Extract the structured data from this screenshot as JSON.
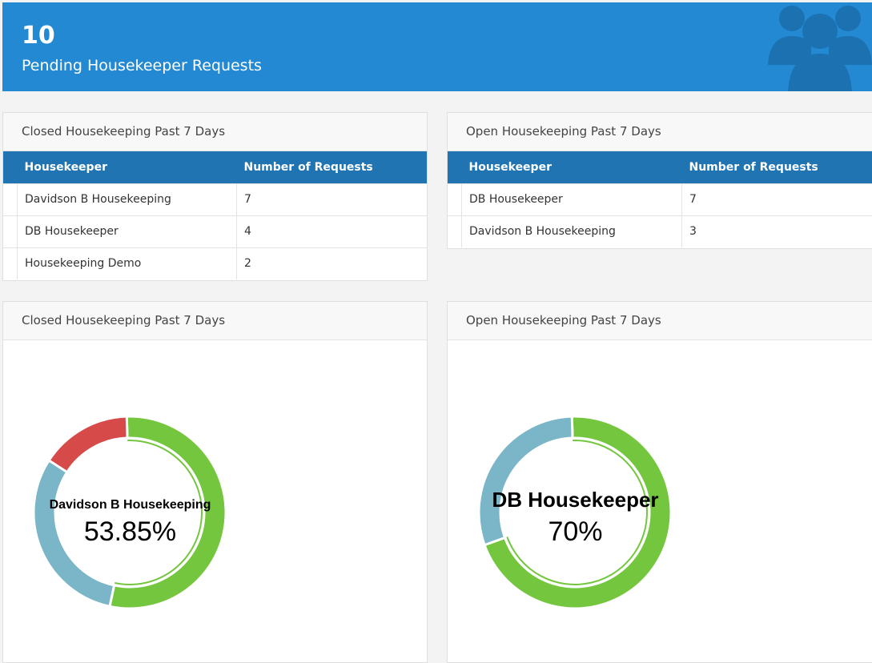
{
  "banner": {
    "count": "10",
    "label": "Pending Housekeeper Requests",
    "icon": "users-icon",
    "color": "#2489d3"
  },
  "closed_table": {
    "title": "Closed Housekeeping Past 7 Days",
    "columns": [
      "Housekeeper",
      "Number of Requests"
    ],
    "rows": [
      [
        "Davidson B Housekeeping",
        "7"
      ],
      [
        "DB Housekeeper",
        "4"
      ],
      [
        "Housekeeping Demo",
        "2"
      ]
    ]
  },
  "open_table": {
    "title": "Open Housekeeping Past 7 Days",
    "columns": [
      "Housekeeper",
      "Number of Requests"
    ],
    "rows": [
      [
        "DB Housekeeper",
        "7"
      ],
      [
        "Davidson B Housekeeping",
        "3"
      ]
    ]
  },
  "closed_chart": {
    "title": "Closed Housekeeping Past 7 Days",
    "center_name": "Davidson B Housekeeping",
    "center_value": "53.85%"
  },
  "open_chart": {
    "title": "Open Housekeeping Past 7 Days",
    "center_name": "DB Housekeeper",
    "center_value": "70%"
  },
  "chart_data": [
    {
      "type": "pie",
      "title": "",
      "categories": [
        "Davidson B Housekeeping",
        "DB Housekeeper",
        "Housekeeping Demo"
      ],
      "values": [
        7,
        4,
        2
      ],
      "colors": [
        "#74c63f",
        "#7ab6c8",
        "#d64a4a"
      ]
    },
    {
      "type": "pie",
      "title": "",
      "categories": [
        "DB Housekeeper",
        "Davidson B Housekeeping"
      ],
      "values": [
        7,
        3
      ],
      "colors": [
        "#74c63f",
        "#7ab6c8"
      ]
    }
  ]
}
